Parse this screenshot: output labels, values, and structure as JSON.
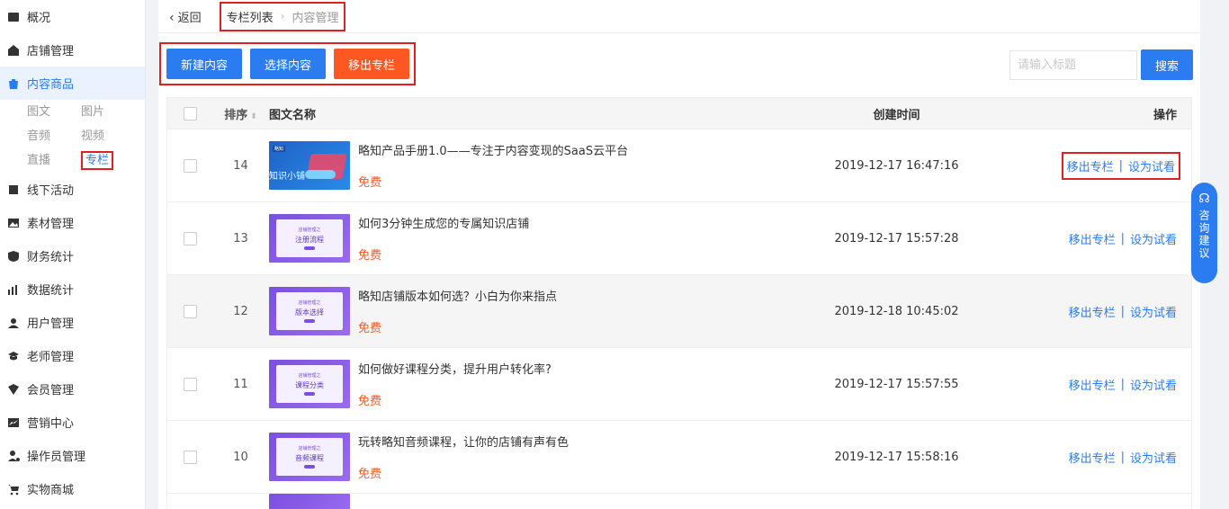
{
  "sidebar": {
    "items": [
      {
        "label": "概况",
        "icon": "overview-icon"
      },
      {
        "label": "店铺管理",
        "icon": "store-icon"
      },
      {
        "label": "内容商品",
        "icon": "bag-icon",
        "active": true
      },
      {
        "label": "线下活动",
        "icon": "flag-icon"
      },
      {
        "label": "素材管理",
        "icon": "image-icon"
      },
      {
        "label": "财务统计",
        "icon": "finance-icon"
      },
      {
        "label": "数据统计",
        "icon": "chart-icon"
      },
      {
        "label": "用户管理",
        "icon": "user-icon"
      },
      {
        "label": "老师管理",
        "icon": "teacher-icon"
      },
      {
        "label": "会员管理",
        "icon": "member-icon"
      },
      {
        "label": "营销中心",
        "icon": "marketing-icon"
      },
      {
        "label": "操作员管理",
        "icon": "operator-icon"
      },
      {
        "label": "实物商城",
        "icon": "cart-icon"
      }
    ],
    "subitems": [
      "图文",
      "图片",
      "音频",
      "视频",
      "直播",
      "专栏"
    ],
    "selected_sub": "专栏"
  },
  "topbar": {
    "back_label": "返回",
    "breadcrumb": [
      "专栏列表",
      "内容管理"
    ]
  },
  "toolbar": {
    "new_label": "新建内容",
    "select_label": "选择内容",
    "remove_label": "移出专栏"
  },
  "search": {
    "placeholder": "请输入标题",
    "button_label": "搜索"
  },
  "table": {
    "headers": {
      "order": "排序",
      "name": "图文名称",
      "time": "创建时间",
      "ops": "操作"
    },
    "rows": [
      {
        "order": "14",
        "title": "略知产品手册1.0——专注于内容变现的SaaS云平台",
        "price": "免费",
        "time": "2019-12-17 16:47:16",
        "thumb_top": "略知",
        "thumb_main": "知识小铺",
        "thumb_style": "blue"
      },
      {
        "order": "13",
        "title": "如何3分钟生成您的专属知识店铺",
        "price": "免费",
        "time": "2019-12-17 15:57:28",
        "thumb_top": "店铺管理之",
        "thumb_main": "注册流程",
        "thumb_style": "purple"
      },
      {
        "order": "12",
        "title": "略知店铺版本如何选？小白为你来指点",
        "price": "免费",
        "time": "2019-12-18 10:45:02",
        "thumb_top": "店铺管理之",
        "thumb_main": "版本选择",
        "thumb_style": "purple"
      },
      {
        "order": "11",
        "title": "如何做好课程分类，提升用户转化率?",
        "price": "免费",
        "time": "2019-12-17 15:57:55",
        "thumb_top": "店铺管理之",
        "thumb_main": "课程分类",
        "thumb_style": "purple"
      },
      {
        "order": "10",
        "title": "玩转略知音频课程，让你的店铺有声有色",
        "price": "免费",
        "time": "2019-12-17 15:58:16",
        "thumb_top": "店铺管理之",
        "thumb_main": "音频课程",
        "thumb_style": "purple"
      }
    ],
    "op_remove": "移出专栏",
    "op_sep": "|",
    "op_trial": "设为试看"
  },
  "float_advice": {
    "label": "咨询建议"
  },
  "colors": {
    "primary": "#2b7cf0",
    "danger": "#ff5722",
    "highlight_box": "#e02020"
  }
}
